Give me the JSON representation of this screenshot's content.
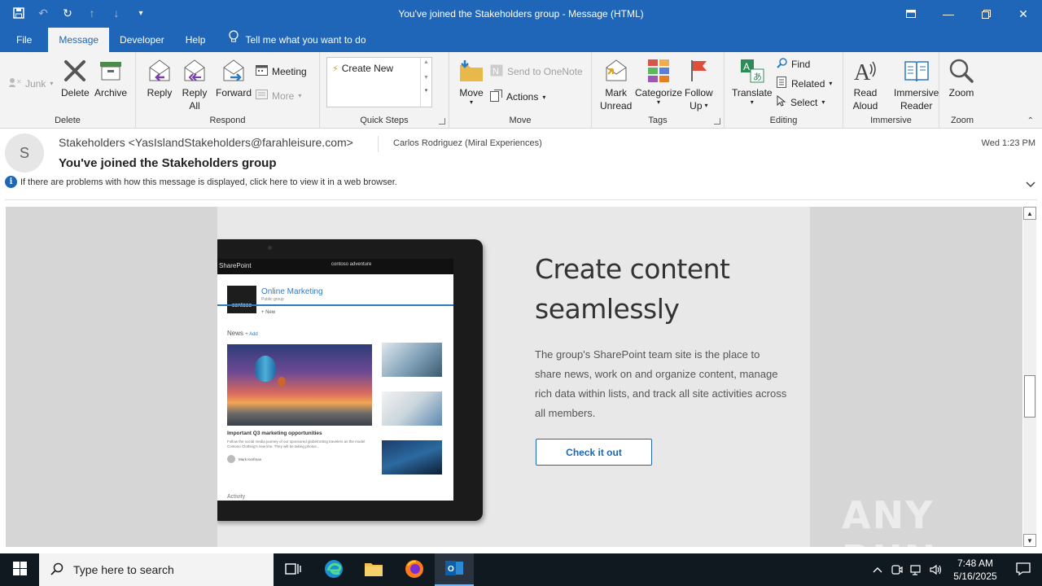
{
  "window": {
    "title": "You've joined the Stakeholders group  -  Message (HTML)"
  },
  "ribbon_tabs": [
    {
      "label": "File"
    },
    {
      "label": "Message"
    },
    {
      "label": "Developer"
    },
    {
      "label": "Help"
    }
  ],
  "tell_me": "Tell me what you want to do",
  "groups": {
    "delete": {
      "label": "Delete",
      "junk": "Junk",
      "delete": "Delete",
      "archive": "Archive"
    },
    "respond": {
      "label": "Respond",
      "reply": "Reply",
      "reply_all_1": "Reply",
      "reply_all_2": "All",
      "forward": "Forward",
      "meeting": "Meeting",
      "more": "More"
    },
    "quick_steps": {
      "label": "Quick Steps",
      "create_new": "Create New"
    },
    "move": {
      "label": "Move",
      "move": "Move",
      "send_onenote": "Send to OneNote",
      "actions": "Actions"
    },
    "tags": {
      "label": "Tags",
      "mark_unread_1": "Mark",
      "mark_unread_2": "Unread",
      "categorize": "Categorize",
      "follow_up_1": "Follow",
      "follow_up_2": "Up"
    },
    "editing": {
      "label": "Editing",
      "translate": "Translate",
      "find": "Find",
      "related": "Related",
      "select": "Select"
    },
    "immersive": {
      "label": "Immersive",
      "read_aloud_1": "Read",
      "read_aloud_2": "Aloud",
      "immersive_reader_1": "Immersive",
      "immersive_reader_2": "Reader"
    },
    "zoom": {
      "label": "Zoom",
      "zoom": "Zoom"
    }
  },
  "message": {
    "avatar_initial": "S",
    "from": "Stakeholders <YasIslandStakeholders@farahleisure.com>",
    "to": "Carlos Rodriguez (Miral Experiences)",
    "date": "Wed 1:23 PM",
    "subject": "You've joined the Stakeholders group",
    "info": "If there are problems with how this message is displayed, click here to view it in a web browser."
  },
  "content": {
    "heading": "Create content seamlessly",
    "paragraph": "The group's SharePoint team site is the place to share news, work on and organize content, manage rich data within lists, and track all site activities across all members.",
    "cta": "Check it out",
    "tablet": {
      "app": "SharePoint",
      "brand": "contoso adventure",
      "logo": "contoso",
      "site": "Online Marketing",
      "site_type": "Public group",
      "new": "+ New",
      "news": "News",
      "add": "+ Add",
      "story_title": "Important Q3 marketing opportunities",
      "story_sub": "Follow the social media journey of our sponsored globetrotting travelers as the model Contoso Clothing's new line. They will be taking photos...",
      "author": "Mark Kerfman",
      "activity": "Activity"
    }
  },
  "watermark": "ANY RUN",
  "taskbar": {
    "search_placeholder": "Type here to search",
    "time": "7:48 AM",
    "date": "5/16/2025"
  },
  "colors": {
    "accent": "#1f66b8",
    "taskbar": "#101820"
  }
}
